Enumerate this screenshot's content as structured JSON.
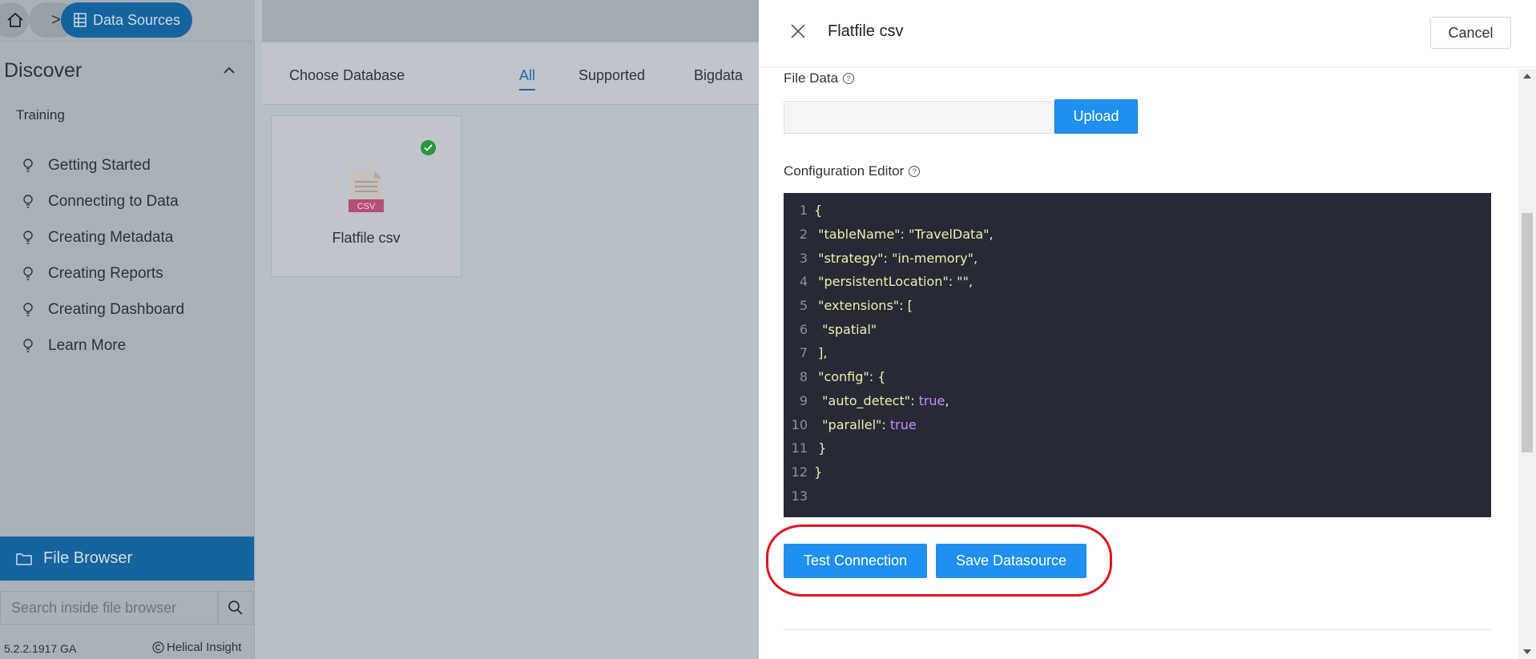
{
  "breadcrumb": {
    "current": "Data Sources"
  },
  "sidebar": {
    "discover_title": "Discover",
    "section_label": "Training",
    "help_items": [
      {
        "label": "Getting Started"
      },
      {
        "label": "Connecting to Data"
      },
      {
        "label": "Creating Metadata"
      },
      {
        "label": "Creating Reports"
      },
      {
        "label": "Creating Dashboard"
      },
      {
        "label": "Learn More"
      }
    ],
    "file_browser_label": "File Browser",
    "search_placeholder": "Search inside file browser",
    "version": "5.2.2.1917 GA",
    "copyright": "Helical Insight"
  },
  "database_panel": {
    "choose_label": "Choose Database",
    "tabs": [
      {
        "label": "All",
        "active": true
      },
      {
        "label": "Supported",
        "active": false
      },
      {
        "label": "Bigdata",
        "active": false
      }
    ],
    "card": {
      "label": "Flatfile csv",
      "icon_text": "CSV",
      "selected": true
    }
  },
  "drawer": {
    "title": "Flatfile csv",
    "cancel_label": "Cancel",
    "file_data_label": "File Data",
    "upload_label": "Upload",
    "config_editor_label": "Configuration Editor",
    "code_lines": [
      "{",
      " \"tableName\": \"TravelData\",",
      " \"strategy\": \"in-memory\",",
      " \"persistentLocation\": \"\",",
      " \"extensions\": [",
      "  \"spatial\"",
      " ],",
      " \"config\": {",
      "  \"auto_detect\": true,",
      "  \"parallel\": true",
      " }",
      "}",
      ""
    ],
    "test_connection_label": "Test Connection",
    "save_datasource_label": "Save Datasource"
  },
  "colors": {
    "primary_button": "#1f8ff0",
    "editor_background": "#272a36",
    "highlight_ring": "#e0141d",
    "selected_check": "#27963c"
  }
}
